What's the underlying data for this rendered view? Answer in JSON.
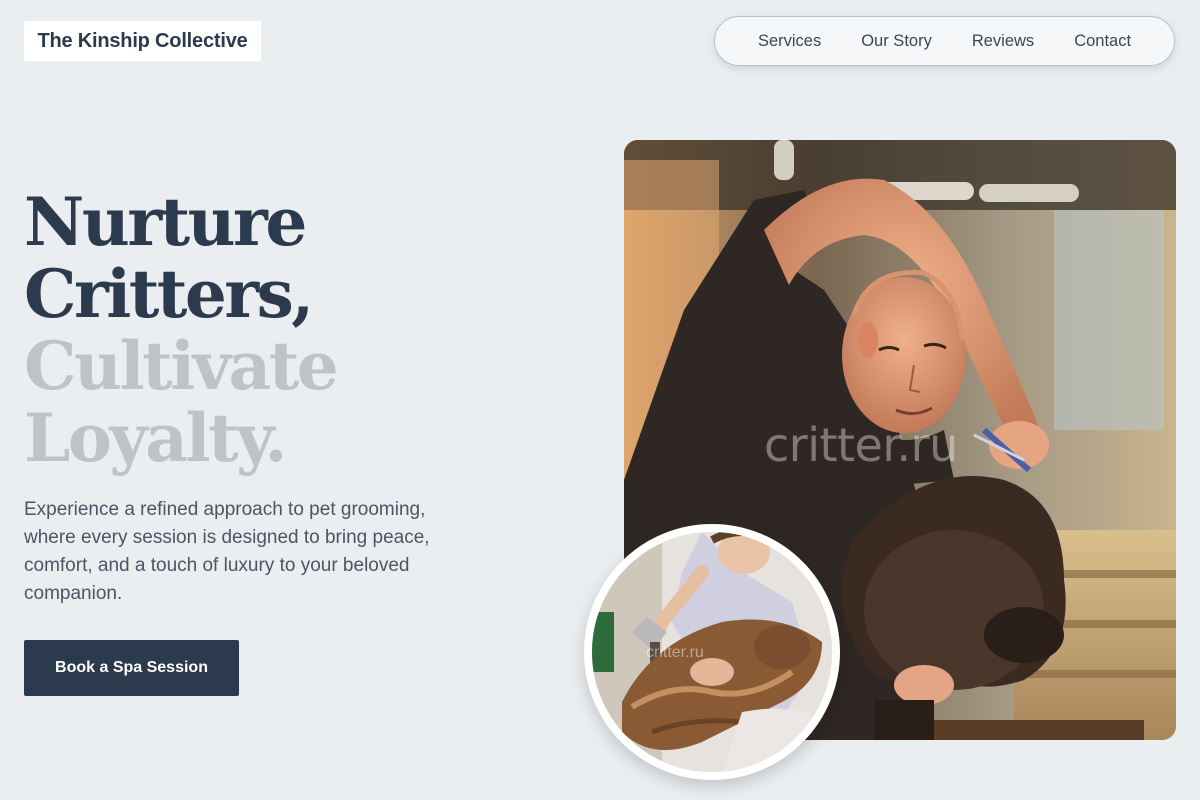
{
  "header": {
    "brand": "The Kinship Collective",
    "nav": [
      {
        "label": "Services"
      },
      {
        "label": "Our Story"
      },
      {
        "label": "Reviews"
      },
      {
        "label": "Contact"
      }
    ]
  },
  "hero": {
    "headline_line1": "Nurture",
    "headline_line2": "Critters,",
    "headline_line3": "Cultivate",
    "headline_line4": "Loyalty.",
    "intro": "Experience a refined approach to pet grooming, where every session is designed to bring peace, comfort, and a touch of luxury to your beloved companion.",
    "cta_label": "Book a Spa Session",
    "main_photo_watermark": "critter.ru",
    "inset_photo_watermark": "critter.ru"
  },
  "colors": {
    "page_background": "#ebeef0",
    "headline_dark": "#2c3a4e",
    "headline_light": "#c0c3c5",
    "button_background": "#2c3a4e"
  }
}
